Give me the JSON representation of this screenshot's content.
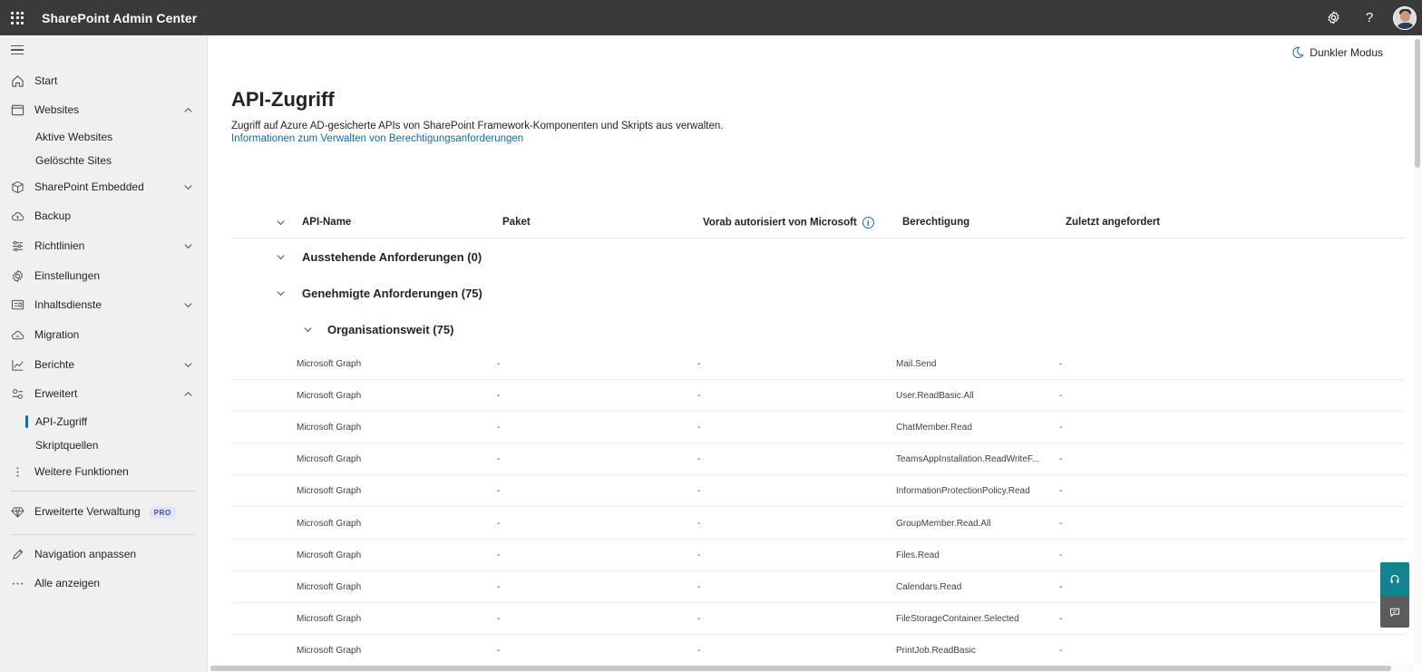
{
  "app": {
    "title": "SharePoint Admin Center"
  },
  "topbar": {
    "settings_icon": "gear-icon",
    "help_label": "?",
    "avatar_icon": "user-avatar"
  },
  "sidebar": {
    "items": [
      {
        "label": "Start",
        "icon": "home-icon"
      },
      {
        "label": "Websites",
        "icon": "browser-window-icon",
        "expanded": true
      },
      {
        "label": "SharePoint Embedded",
        "icon": "box-icon"
      },
      {
        "label": "Backup",
        "icon": "cloud-backup-icon"
      },
      {
        "label": "Richtlinien",
        "icon": "sliders-icon"
      },
      {
        "label": "Einstellungen",
        "icon": "gear-icon"
      },
      {
        "label": "Inhaltsdienste",
        "icon": "content-icon"
      },
      {
        "label": "Migration",
        "icon": "cloud-upload-icon"
      },
      {
        "label": "Berichte",
        "icon": "chart-line-icon"
      },
      {
        "label": "Erweitert",
        "icon": "advanced-settings-icon",
        "expanded": true
      },
      {
        "label": "Weitere Funktionen",
        "icon": "more-vertical-icon"
      },
      {
        "label": "Erweiterte Verwaltung",
        "icon": "diamond-icon",
        "badge": "PRO"
      },
      {
        "label": "Navigation anpassen",
        "icon": "pencil-icon"
      },
      {
        "label": "Alle anzeigen",
        "icon": "more-horizontal-icon"
      }
    ],
    "websites_sub": [
      "Aktive Websites",
      "Gelöschte Sites"
    ],
    "erweitert_sub": [
      "API-Zugriff",
      "Skriptquellen"
    ],
    "active": "API-Zugriff"
  },
  "main": {
    "dark_mode_label": "Dunkler Modus",
    "title": "API-Zugriff",
    "description": "Zugriff auf Azure AD-gesicherte APIs von SharePoint Framework-Komponenten und Skripts aus verwalten.",
    "link": "Informationen zum Verwalten von Berechtigungsanforderungen",
    "columns": [
      "API-Name",
      "Paket",
      "Vorab autorisiert von Microsoft",
      "Berechtigung",
      "Zuletzt angefordert"
    ],
    "groups": {
      "pending": "Ausstehende Anforderungen (0)",
      "approved": "Genehmigte Anforderungen (75)",
      "org": "Organisationsweit (75)"
    },
    "rows": [
      {
        "api": "Microsoft Graph",
        "package": "-",
        "preauth": "-",
        "permission": "Mail.Send",
        "last": "-"
      },
      {
        "api": "Microsoft Graph",
        "package": "-",
        "preauth": "-",
        "permission": "User.ReadBasic.All",
        "last": "-"
      },
      {
        "api": "Microsoft Graph",
        "package": "-",
        "preauth": "-",
        "permission": "ChatMember.Read",
        "last": "-"
      },
      {
        "api": "Microsoft Graph",
        "package": "-",
        "preauth": "-",
        "permission": "TeamsAppInstallation.ReadWriteF...",
        "last": "-"
      },
      {
        "api": "Microsoft Graph",
        "package": "-",
        "preauth": "-",
        "permission": "InformationProtectionPolicy.Read",
        "last": "-"
      },
      {
        "api": "Microsoft Graph",
        "package": "-",
        "preauth": "-",
        "permission": "GroupMember.Read.All",
        "last": "-"
      },
      {
        "api": "Microsoft Graph",
        "package": "-",
        "preauth": "-",
        "permission": "Files.Read",
        "last": "-"
      },
      {
        "api": "Microsoft Graph",
        "package": "-",
        "preauth": "-",
        "permission": "Calendars.Read",
        "last": "-"
      },
      {
        "api": "Microsoft Graph",
        "package": "-",
        "preauth": "-",
        "permission": "FileStorageContainer.Selected",
        "last": "-"
      },
      {
        "api": "Microsoft Graph",
        "package": "-",
        "preauth": "-",
        "permission": "PrintJob.ReadBasic",
        "last": "-"
      }
    ]
  },
  "colors": {
    "topbar": "#3a3a3a",
    "accent": "#0f6cbd",
    "help_button": "#13838f"
  }
}
